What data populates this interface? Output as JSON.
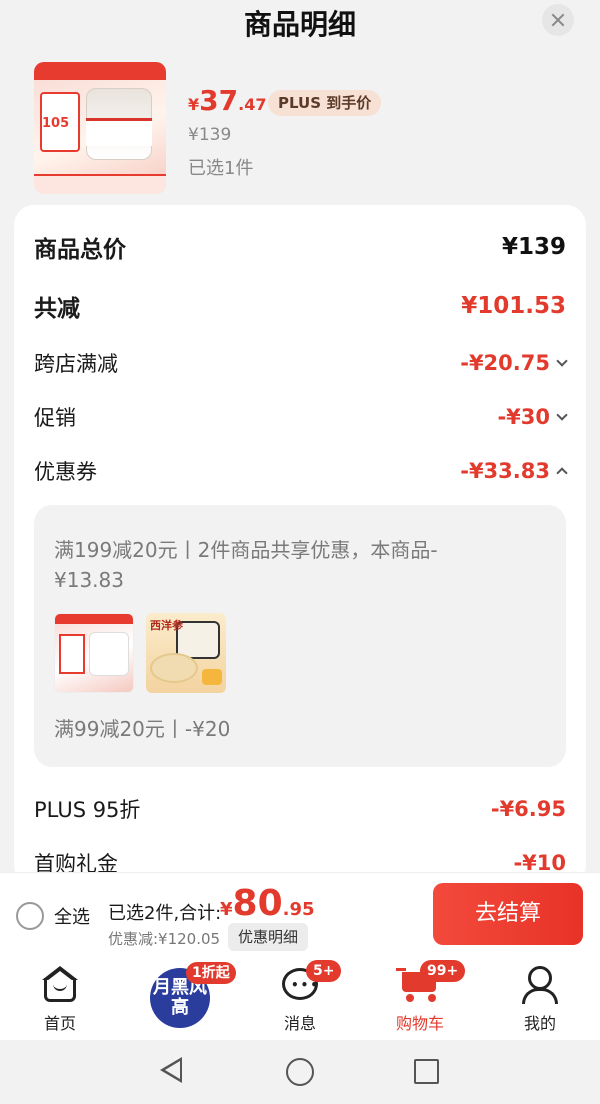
{
  "header": {
    "title": "商品明细"
  },
  "product": {
    "thumb_price_text": "105",
    "price_yen": "¥",
    "price_int": "37",
    "price_dec": ".47",
    "plus_tag": "PLUS 到手价",
    "original_price": "¥139",
    "selected_count": "已选1件"
  },
  "breakdown": {
    "total": {
      "label": "商品总价",
      "value": "¥139"
    },
    "reduction": {
      "label": "共减",
      "value": "¥101.53"
    },
    "cross_store": {
      "label": "跨店满减",
      "value": "-¥20.75"
    },
    "promotion": {
      "label": "促销",
      "value": "-¥30"
    },
    "coupon": {
      "label": "优惠券",
      "value": "-¥33.83"
    },
    "plus_discount": {
      "label": "PLUS 95折",
      "value": "-¥6.95"
    },
    "first_purchase": {
      "label": "首购礼金",
      "value": "-¥10"
    }
  },
  "coupon_detail": {
    "line1": "满199减20元丨2件商品共享优惠，本商品-¥13.83",
    "line2": "满99减20元丨-¥20",
    "thumb2_tag": "西洋参"
  },
  "checkout": {
    "select_all": "全选",
    "total_label": "已选2件,合计:",
    "total_yen": "¥",
    "total_int": "80",
    "total_dec": ".95",
    "saved": "优惠减:¥120.05",
    "detail_button": "优惠明细",
    "checkout_button": "去结算"
  },
  "tabbar": {
    "home": "首页",
    "promo_text": "月黑风高",
    "promo_badge": "1折起",
    "messages": "消息",
    "messages_badge": "5+",
    "cart": "购物车",
    "cart_badge": "99+",
    "me": "我的",
    "active_color": "#e23a2d"
  },
  "colors": {
    "accent": "#e23a2d",
    "checkout_button": "#e83228",
    "background": "#f2f2f2"
  }
}
